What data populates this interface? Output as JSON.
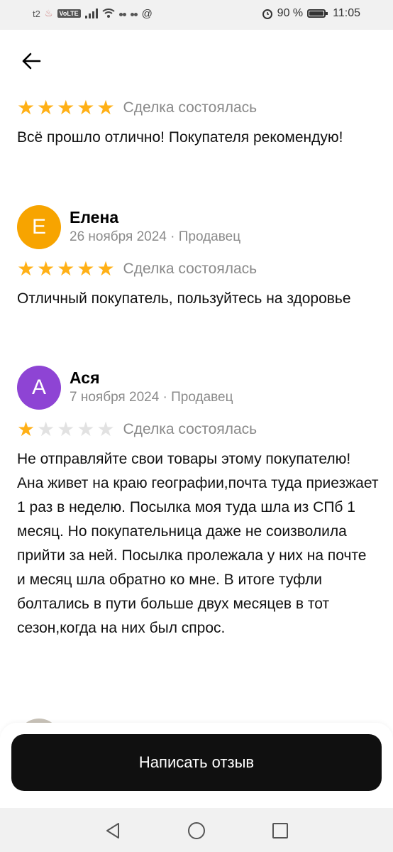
{
  "status_bar": {
    "carrier": "t2",
    "volte": "VoLTE",
    "battery": "90 %",
    "battery_level": 0.9,
    "time": "11:05",
    "at_symbol": "@"
  },
  "reviews": [
    {
      "rating": 5,
      "deal_status": "Сделка состоялась",
      "text": "Всё прошло отлично! Покупателя рекомендую!"
    },
    {
      "avatar_letter": "Е",
      "avatar_color": "#f7a400",
      "name": "Елена",
      "meta": "26 ноября 2024 · Продавец",
      "rating": 5,
      "deal_status": "Сделка состоялась",
      "text": "Отличный покупатель, пользуйтесь на здоровье"
    },
    {
      "avatar_letter": "А",
      "avatar_color": "#8e44d4",
      "name": "Ася",
      "meta": "7 ноября 2024 · Продавец",
      "rating": 1,
      "deal_status": "Сделка состоялась",
      "text": "Не отправляйте свои товары этому покупателю! Ана живет на краю географии,почта туда приезжает 1 раз в неделю. Посылка моя туда шла из СПб 1 месяц. Но покупательница даже не соизволила прийти за ней. Посылка пролежала у них на почте и месяц шла обратно ко мне. В итоге туфли болтались в пути больше двух месяцев в тот сезон,когда на них был спрос."
    }
  ],
  "write_review_label": "Написать отзыв",
  "colors": {
    "star_on": "#ffb016",
    "star_off": "#e2e2e2",
    "button_bg": "#101010"
  }
}
